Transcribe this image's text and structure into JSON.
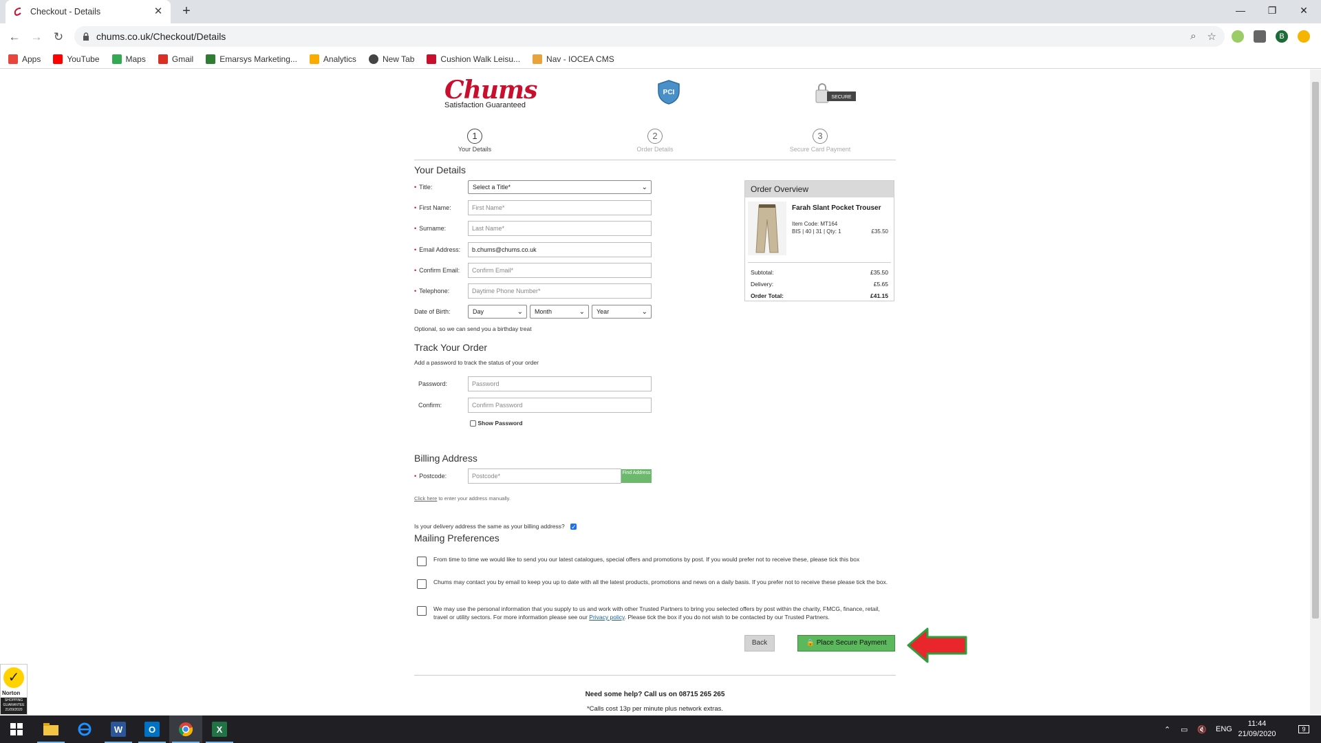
{
  "browser": {
    "tab_title": "Checkout - Details",
    "tab_close": "✕",
    "new_tab": "+",
    "url": "chums.co.uk/Checkout/Details",
    "window_controls": {
      "minimize": "—",
      "restore": "❐",
      "close": "✕"
    },
    "profile_initial": "B"
  },
  "bookmarks": [
    {
      "label": "Apps",
      "color": "#e8453c"
    },
    {
      "label": "YouTube",
      "color": "#ff0000"
    },
    {
      "label": "Maps",
      "color": "#34a853"
    },
    {
      "label": "Gmail",
      "color": "#d93025"
    },
    {
      "label": "Emarsys Marketing...",
      "color": "#2e7d32"
    },
    {
      "label": "Analytics",
      "color": "#f9ab00"
    },
    {
      "label": "New Tab",
      "color": "#444444"
    },
    {
      "label": "Cushion Walk Leisu...",
      "color": "#c8102e"
    },
    {
      "label": "Nav - IOCEA CMS",
      "color": "#e8a33c"
    }
  ],
  "header": {
    "logo_text": "Chums",
    "logo_tagline": "Satisfaction Guaranteed",
    "pci_text": "PCI",
    "secure_text": "SECURE"
  },
  "steps": [
    {
      "number": "1",
      "label": "Your Details"
    },
    {
      "number": "2",
      "label": "Order Details"
    },
    {
      "number": "3",
      "label": "Secure Card Payment"
    }
  ],
  "your_details": {
    "heading": "Your Details",
    "required_mark": "•",
    "title_label": "Title:",
    "title_value": "Select a Title*",
    "first_name_label": "First Name:",
    "first_name_placeholder": "First Name*",
    "surname_label": "Surname:",
    "surname_placeholder": "Last Name*",
    "email_label": "Email Address:",
    "email_value": "b.chums@chums.co.uk",
    "confirm_email_label": "Confirm Email:",
    "confirm_email_placeholder": "Confirm Email*",
    "telephone_label": "Telephone:",
    "telephone_placeholder": "Daytime Phone Number*",
    "dob_label": "Date of Birth:",
    "dob_day": "Day",
    "dob_month": "Month",
    "dob_year": "Year",
    "dob_note": "Optional, so we can send you a birthday treat"
  },
  "track_order": {
    "heading": "Track Your Order",
    "note": "Add a password to track the status of your order",
    "password_label": "Password:",
    "password_placeholder": "Password",
    "confirm_label": "Confirm:",
    "confirm_placeholder": "Confirm Password",
    "show_password": "Show Password"
  },
  "billing": {
    "heading": "Billing Address",
    "postcode_label": "Postcode:",
    "postcode_placeholder": "Postcode*",
    "find_button": "Find Address",
    "click_here": "Click here",
    "manual_note": "to enter your address manually.",
    "same_delivery": "Is your delivery address the same as your billing address?",
    "same_delivery_checked": true
  },
  "mailing": {
    "heading": "Mailing Preferences",
    "pref1": "From time to time we would like to send you our latest catalogues, special offers and promotions by post. If you would prefer not to receive these, please tick this box",
    "pref2": "Chums may contact you by email to keep you up to date with all the latest products, promotions and news on a daily basis. If you prefer not to receive these please tick the box.",
    "pref3_before": "We may use the personal information that you supply to us and work with other Trusted Partners to bring you selected offers by post within the charity, FMCG, finance, retail, travel or utility sectors. For more information please see our",
    "pref3_link": "Privacy policy",
    "pref3_after": ". Please tick the box if you do not wish to be contacted by our Trusted Partners."
  },
  "actions": {
    "back": "Back",
    "place_payment": "Place Secure Payment",
    "arrow_color": "#e8262b",
    "arrow_outline": "#2e9e3e"
  },
  "order_overview": {
    "heading": "Order Overview",
    "product_name": "Farah Slant Pocket Trouser",
    "item_code": "Item Code: MT164",
    "spec": "BIS | 40 | 31 | Qty: 1",
    "price": "£35.50",
    "subtotal_label": "Subtotal:",
    "subtotal": "£35.50",
    "delivery_label": "Delivery:",
    "delivery": "£5.65",
    "total_label": "Order Total:",
    "total": "£41.15"
  },
  "footer": {
    "help": "Need some help? Call us on 08715 265 265",
    "calls_note": "*Calls cost 13p per minute plus network extras."
  },
  "norton": {
    "name": "Norton",
    "band": "SHOPPING GUARANTEE",
    "date": "21/09/2020"
  },
  "taskbar": {
    "language": "ENG",
    "time": "11:44",
    "date": "21/09/2020",
    "notification_count": "9"
  }
}
